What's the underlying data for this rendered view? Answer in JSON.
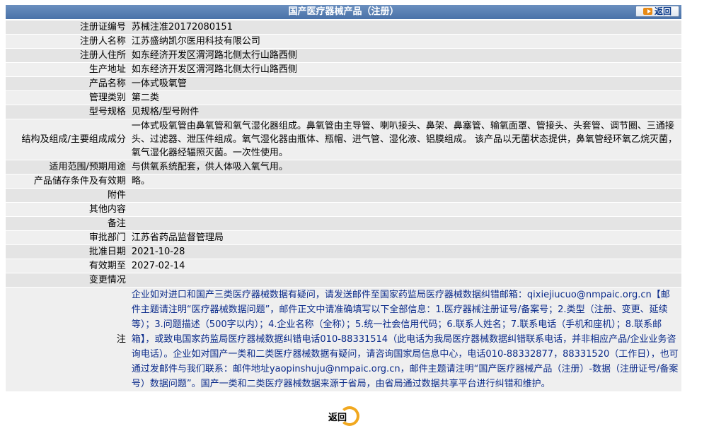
{
  "header": {
    "title": "国产医疗器械产品（注册）",
    "back_label": "返回"
  },
  "rows": [
    {
      "label": "注册证编号",
      "value": "苏械注准20172080151"
    },
    {
      "label": "注册人名称",
      "value": "江苏盛纳凯尔医用科技有限公司"
    },
    {
      "label": "注册人住所",
      "value": "如东经济开发区渭河路北侧太行山路西侧"
    },
    {
      "label": "生产地址",
      "value": "如东经济开发区渭河路北侧太行山路西侧"
    },
    {
      "label": "产品名称",
      "value": "一体式吸氧管"
    },
    {
      "label": "管理类别",
      "value": "第二类"
    },
    {
      "label": "型号规格",
      "value": "见规格/型号附件"
    },
    {
      "label": "结构及组成/主要组成成分",
      "value": "一体式吸氧管由鼻氧管和氧气湿化器组成。鼻氧管由主导管、喇叭接头、鼻架、鼻塞管、输氧面罩、管接头、头套管、调节圈、三通接头、过滤器、泄压件组成。氧气湿化器由瓶体、瓶帽、进气管、湿化液、铝膜组成。 该产品以无菌状态提供，鼻氧管经环氧乙烷灭菌，氧气湿化器经辐照灭菌。一次性使用。"
    },
    {
      "label": "适用范围/预期用途",
      "value": "与供氧系统配套，供人体吸入氧气用。"
    },
    {
      "label": "产品储存条件及有效期",
      "value": "略。"
    },
    {
      "label": "附件",
      "value": ""
    },
    {
      "label": "其他内容",
      "value": ""
    },
    {
      "label": "备注",
      "value": ""
    },
    {
      "label": "审批部门",
      "value": "江苏省药品监督管理局"
    },
    {
      "label": "批准日期",
      "value": "2021-10-28"
    },
    {
      "label": "有效期至",
      "value": "2027-02-14"
    },
    {
      "label": "变更情况",
      "value": ""
    }
  ],
  "note": {
    "label": "注",
    "text": "企业如对进口和国产三类医疗器械数据有疑问，请发送邮件至国家药监局医疗器械数据纠错邮箱：qixiejiucuo@nmpaic.org.cn【邮件主题请注明“医疗器械数据问题”，邮件正文中请准确填写以下全部信息：1.医疗器械注册证号/备案号；2.类型（注册、变更、延续等）；3.问题描述（500字以内）；4.企业名称（全称）；5.统一社会信用代码；6.联系人姓名；7.联系电话（手机和座机）；8.联系邮箱】，或致电国家药监局医疗器械数据纠错电话010-88331514（此电话为我局医疗器械数据纠错联系电话，并非相应产品/企业业务咨询电话）。企业如对国产一类和二类医疗器械数据有疑问，请咨询国家局信息中心，电话010-88332877，88331520（工作日），也可通过发邮件与我们联系：邮件地址yaopinshuju@nmpaic.org.cn，邮件主题请注明“国产医疗器械产品（注册）-数据（注册证号/备案号）数据问题”。国产一类和二类医疗器械数据来源于省局，由省局通过数据共享平台进行纠错和维护。"
  },
  "footer": {
    "back_label": "返回"
  },
  "colors": {
    "header_bg": "#4a72a8",
    "row_dark": "#e4e4e4",
    "row_light": "#efefef",
    "note_text": "#0a2a8a",
    "accent_orange": "#f1a81f"
  }
}
